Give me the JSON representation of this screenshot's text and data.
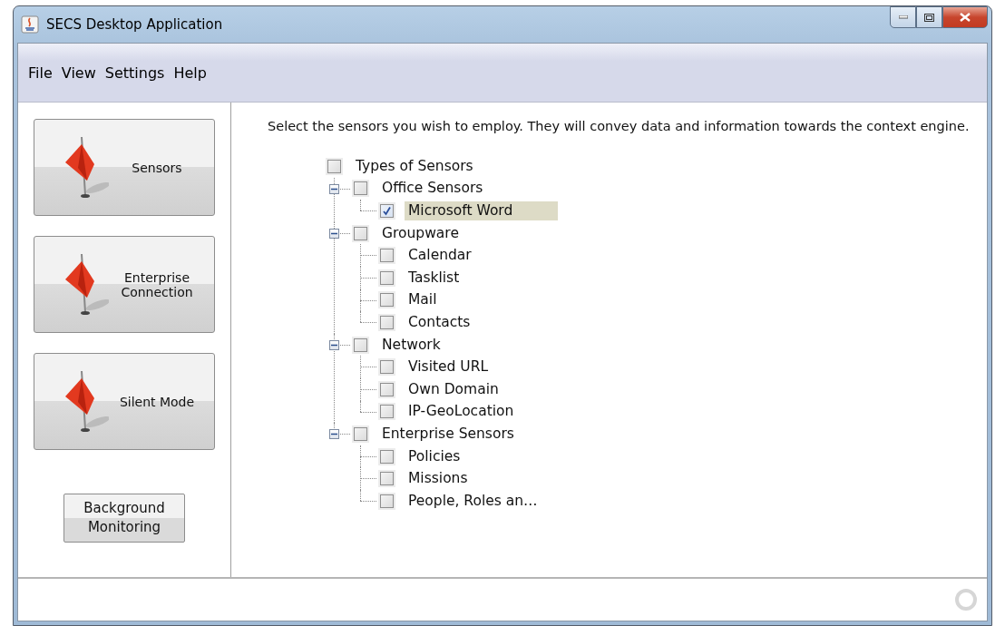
{
  "window": {
    "title": "SECS Desktop Application"
  },
  "menu": [
    "File",
    "View",
    "Settings",
    "Help"
  ],
  "sidebar": {
    "buttons": [
      {
        "label": "Sensors",
        "kind": "flag"
      },
      {
        "label": "Enterprise Connection",
        "kind": "flag"
      },
      {
        "label": "Silent Mode",
        "kind": "flag"
      },
      {
        "label": "Background Monitoring",
        "kind": "plain"
      }
    ]
  },
  "instructions": "Select the sensors you wish to employ. They will convey data and information towards the context engine.",
  "tree": {
    "label": "Types of Sensors",
    "checked": false,
    "selected": false,
    "children": [
      {
        "label": "Office Sensors",
        "checked": false,
        "selected": false,
        "expanded": true,
        "children": [
          {
            "label": "Microsoft Word",
            "checked": true,
            "selected": true
          }
        ]
      },
      {
        "label": "Groupware",
        "checked": false,
        "selected": false,
        "expanded": true,
        "children": [
          {
            "label": "Calendar",
            "checked": false,
            "selected": false
          },
          {
            "label": "Tasklist",
            "checked": false,
            "selected": false
          },
          {
            "label": "Mail",
            "checked": false,
            "selected": false
          },
          {
            "label": "Contacts",
            "checked": false,
            "selected": false
          }
        ]
      },
      {
        "label": "Network",
        "checked": false,
        "selected": false,
        "expanded": true,
        "children": [
          {
            "label": "Visited URL",
            "checked": false,
            "selected": false
          },
          {
            "label": "Own Domain",
            "checked": false,
            "selected": false
          },
          {
            "label": "IP-GeoLocation",
            "checked": false,
            "selected": false
          }
        ]
      },
      {
        "label": "Enterprise Sensors",
        "checked": false,
        "selected": false,
        "expanded": true,
        "children": [
          {
            "label": "Policies",
            "checked": false,
            "selected": false
          },
          {
            "label": "Missions",
            "checked": false,
            "selected": false
          },
          {
            "label": "People, Roles an…",
            "checked": false,
            "selected": false
          }
        ]
      }
    ]
  }
}
